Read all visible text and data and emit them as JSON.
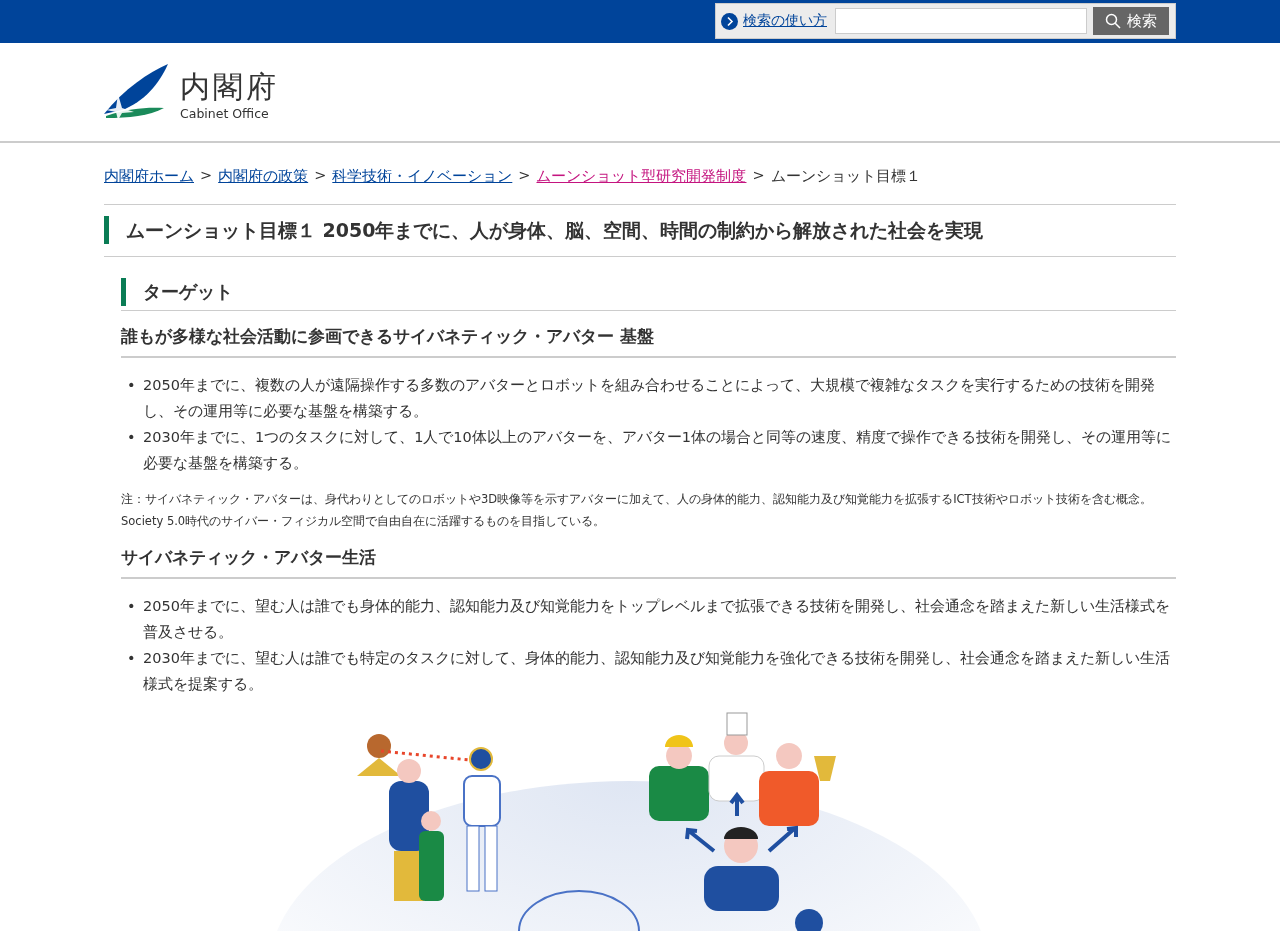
{
  "search": {
    "help_link": "検索の使い方",
    "button": "検索"
  },
  "logo": {
    "name": "内閣府",
    "english": "Cabinet Office"
  },
  "breadcrumb_separator": ">",
  "bullet_marker": "•",
  "breadcrumb": [
    {
      "label": "内閣府ホーム",
      "kind": "link",
      "visited": false
    },
    {
      "label": "内閣府の政策",
      "kind": "link",
      "visited": false
    },
    {
      "label": "科学技術・イノベーション",
      "kind": "link",
      "visited": false
    },
    {
      "label": "ムーンショット型研究開発制度",
      "kind": "link",
      "visited": true
    },
    {
      "label": "ムーンショット目標１",
      "kind": "current"
    }
  ],
  "title": "ムーンショット目標１ 2050年までに、人が身体、脳、空間、時間の制約から解放された社会を実現",
  "section": {
    "heading": "ターゲット",
    "subsections": [
      {
        "heading": "誰もが多様な社会活動に参画できるサイバネティック・アバター 基盤",
        "bullets": [
          "2050年までに、複数の人が遠隔操作する多数のアバターとロボットを組み合わせることによって、大規模で複雑なタスクを実行するための技術を開発し、その運用等に必要な基盤を構築する。",
          "2030年までに、1つのタスクに対して、1人で10体以上のアバターを、アバター1体の場合と同等の速度、精度で操作できる技術を開発し、その運用等に必要な基盤を構築する。"
        ],
        "notes": [
          "注：サイバネティック・アバターは、身代わりとしてのロボットや3D映像等を示すアバターに加えて、人の身体的能力、認知能力及び知覚能力を拡張するICT技術やロボット技術を含む概念。",
          "Society 5.0時代のサイバー・フィジカル空間で自由自在に活躍するものを目指している。"
        ]
      },
      {
        "heading": "サイバネティック・アバター生活",
        "bullets": [
          "2050年までに、望む人は誰でも身体的能力、認知能力及び知覚能力をトップレベルまで拡張できる技術を開発し、社会通念を踏まえた新しい生活様式を普及させる。",
          "2030年までに、望む人は誰でも特定のタスクに対して、身体的能力、認知能力及び知覚能力を強化できる技術を開発し、社会通念を踏まえた新しい生活様式を提案する。"
        ]
      }
    ]
  }
}
